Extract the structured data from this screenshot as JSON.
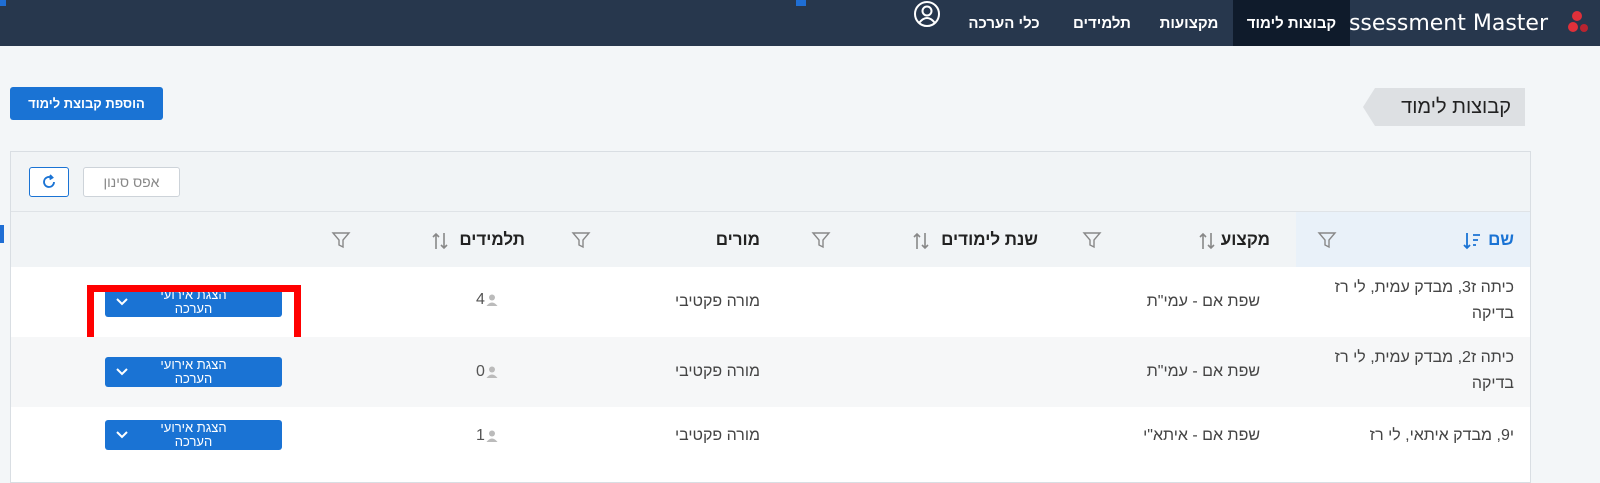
{
  "app": {
    "name": "Assessment Master",
    "nav": [
      {
        "label": "קבוצות לימוד",
        "active": true
      },
      {
        "label": "מקצועות",
        "active": false
      },
      {
        "label": "תלמידים",
        "active": false
      },
      {
        "label": "כלי הערכה",
        "active": false
      }
    ]
  },
  "page": {
    "title": "קבוצות לימוד",
    "add_button": "הוספת קבוצת לימוד",
    "reset_filter": "אפס סינון"
  },
  "table": {
    "columns": {
      "name": "שם",
      "subject": "מקצוע",
      "year": "שנת לימודים",
      "teachers": "מורים",
      "students": "תלמידים"
    },
    "rows": [
      {
        "name": "כיתה ז3, מבדק עמית, לי רז בדיקה",
        "subject": "שפת אם - עמי\"ת",
        "teachers": "מורה פקטיבי",
        "students": "4",
        "action": "הצגת אירועי הערכה"
      },
      {
        "name": "כיתה ז2, מבדק עמית, לי רז בדיקה",
        "subject": "שפת אם - עמי\"ת",
        "teachers": "מורה פקטיבי",
        "students": "0",
        "action": "הצגת אירועי הערכה"
      },
      {
        "name": "י9, מבדק איתאי, לי רז",
        "subject": "שפת אם - איתא\"י",
        "teachers": "מורה פקטיבי",
        "students": "1",
        "action": "הצגת אירועי הערכה"
      }
    ]
  },
  "colors": {
    "topbar": "#27374d",
    "accent": "#1a73d4",
    "highlight": "#ff0000"
  }
}
